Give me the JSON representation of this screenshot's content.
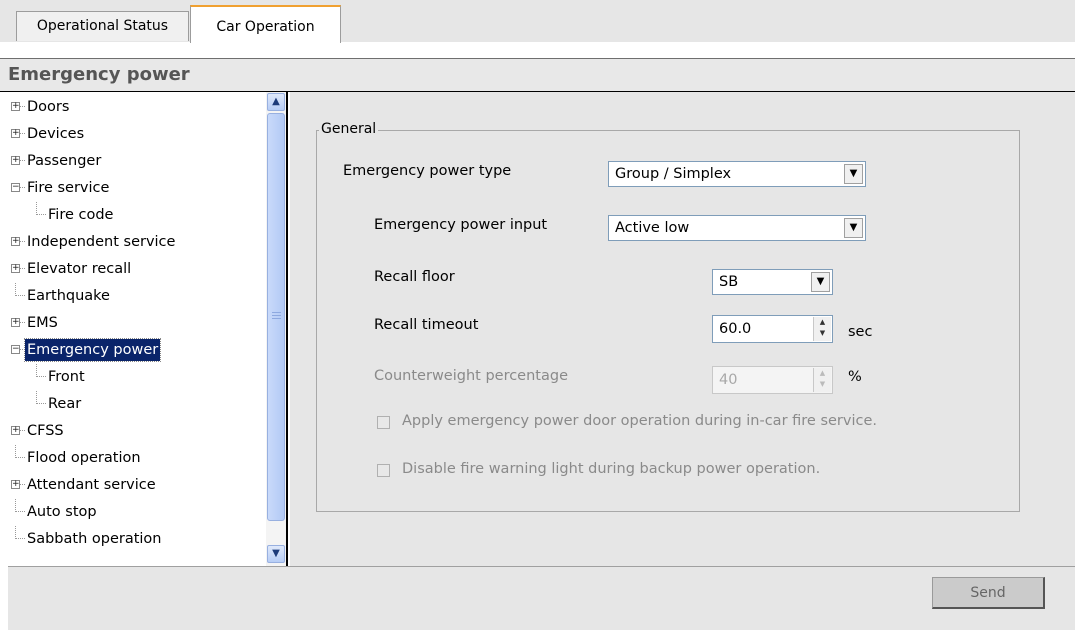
{
  "tabs": [
    {
      "label": "Operational Status",
      "active": false
    },
    {
      "label": "Car Operation",
      "active": true
    }
  ],
  "page_title": "Emergency power",
  "tree": [
    {
      "label": "Doors",
      "expander": "+"
    },
    {
      "label": "Devices",
      "expander": "+"
    },
    {
      "label": "Passenger",
      "expander": "+"
    },
    {
      "label": "Fire service",
      "expander": "-"
    },
    {
      "label": "Fire code",
      "expander": ""
    },
    {
      "label": "Independent service",
      "expander": "+"
    },
    {
      "label": "Elevator recall",
      "expander": "+"
    },
    {
      "label": "Earthquake",
      "expander": ""
    },
    {
      "label": "EMS",
      "expander": "+"
    },
    {
      "label": "Emergency power",
      "expander": "-",
      "selected": true
    },
    {
      "label": "Front",
      "expander": ""
    },
    {
      "label": "Rear",
      "expander": ""
    },
    {
      "label": "CFSS",
      "expander": "+"
    },
    {
      "label": "Flood operation",
      "expander": ""
    },
    {
      "label": "Attendant service",
      "expander": "+"
    },
    {
      "label": "Auto stop",
      "expander": ""
    },
    {
      "label": "Sabbath operation",
      "expander": ""
    }
  ],
  "general": {
    "legend": "General",
    "emergency_power_type": {
      "label": "Emergency power type",
      "value": "Group / Simplex"
    },
    "emergency_power_input": {
      "label": "Emergency power input",
      "value": "Active low"
    },
    "recall_floor": {
      "label": "Recall floor",
      "value": "SB"
    },
    "recall_timeout": {
      "label": "Recall timeout",
      "value": "60.0",
      "unit": "sec"
    },
    "counterweight_percentage": {
      "label": "Counterweight percentage",
      "value": "40",
      "unit": "%",
      "enabled": false
    },
    "apply_door_operation": {
      "label": "Apply emergency power door operation during in-car fire service.",
      "checked": false,
      "enabled": false
    },
    "disable_fire_warning": {
      "label": "Disable fire warning light during backup power operation.",
      "checked": false,
      "enabled": false
    }
  },
  "footer": {
    "send_label": "Send"
  },
  "colors": {
    "tab_accent": "#f0a030",
    "selection": "#0a246a",
    "panel_bg": "#e6e6e6"
  }
}
